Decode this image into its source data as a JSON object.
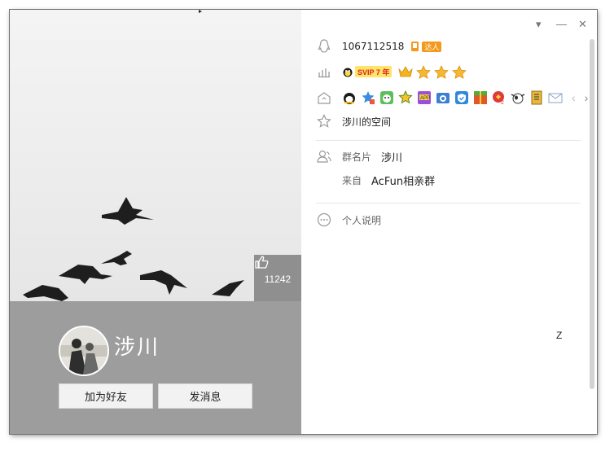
{
  "profile": {
    "nickname": "涉川",
    "like_count": "11242",
    "add_friend_label": "加为好友",
    "send_message_label": "发消息"
  },
  "info": {
    "qq_number": "1067112518",
    "daren_label": "达人",
    "svip_label": "SVIP 7 年",
    "star_count": 3,
    "space_label": "涉川的空间",
    "group_card_label": "群名片",
    "group_card_value": "涉川",
    "from_label": "来自",
    "from_value": "AcFun相亲群",
    "personal_desc_label": "个人说明",
    "side_text": "Z"
  },
  "window_controls": {
    "menu": "▾",
    "minimize": "—",
    "close": "✕"
  },
  "service_icons": [
    "qq-icon",
    "star-icon",
    "pet-icon",
    "gold-star-icon",
    "app-icon",
    "camera-icon",
    "security-icon",
    "game-icon",
    "badge-icon",
    "cow-icon",
    "mail-icon"
  ],
  "colors": {
    "profile_panel": "#9d9d9d",
    "like_box": "#8f8f8f",
    "accent_orange": "#f39a1e",
    "svip_yellow": "#ffe36b"
  }
}
